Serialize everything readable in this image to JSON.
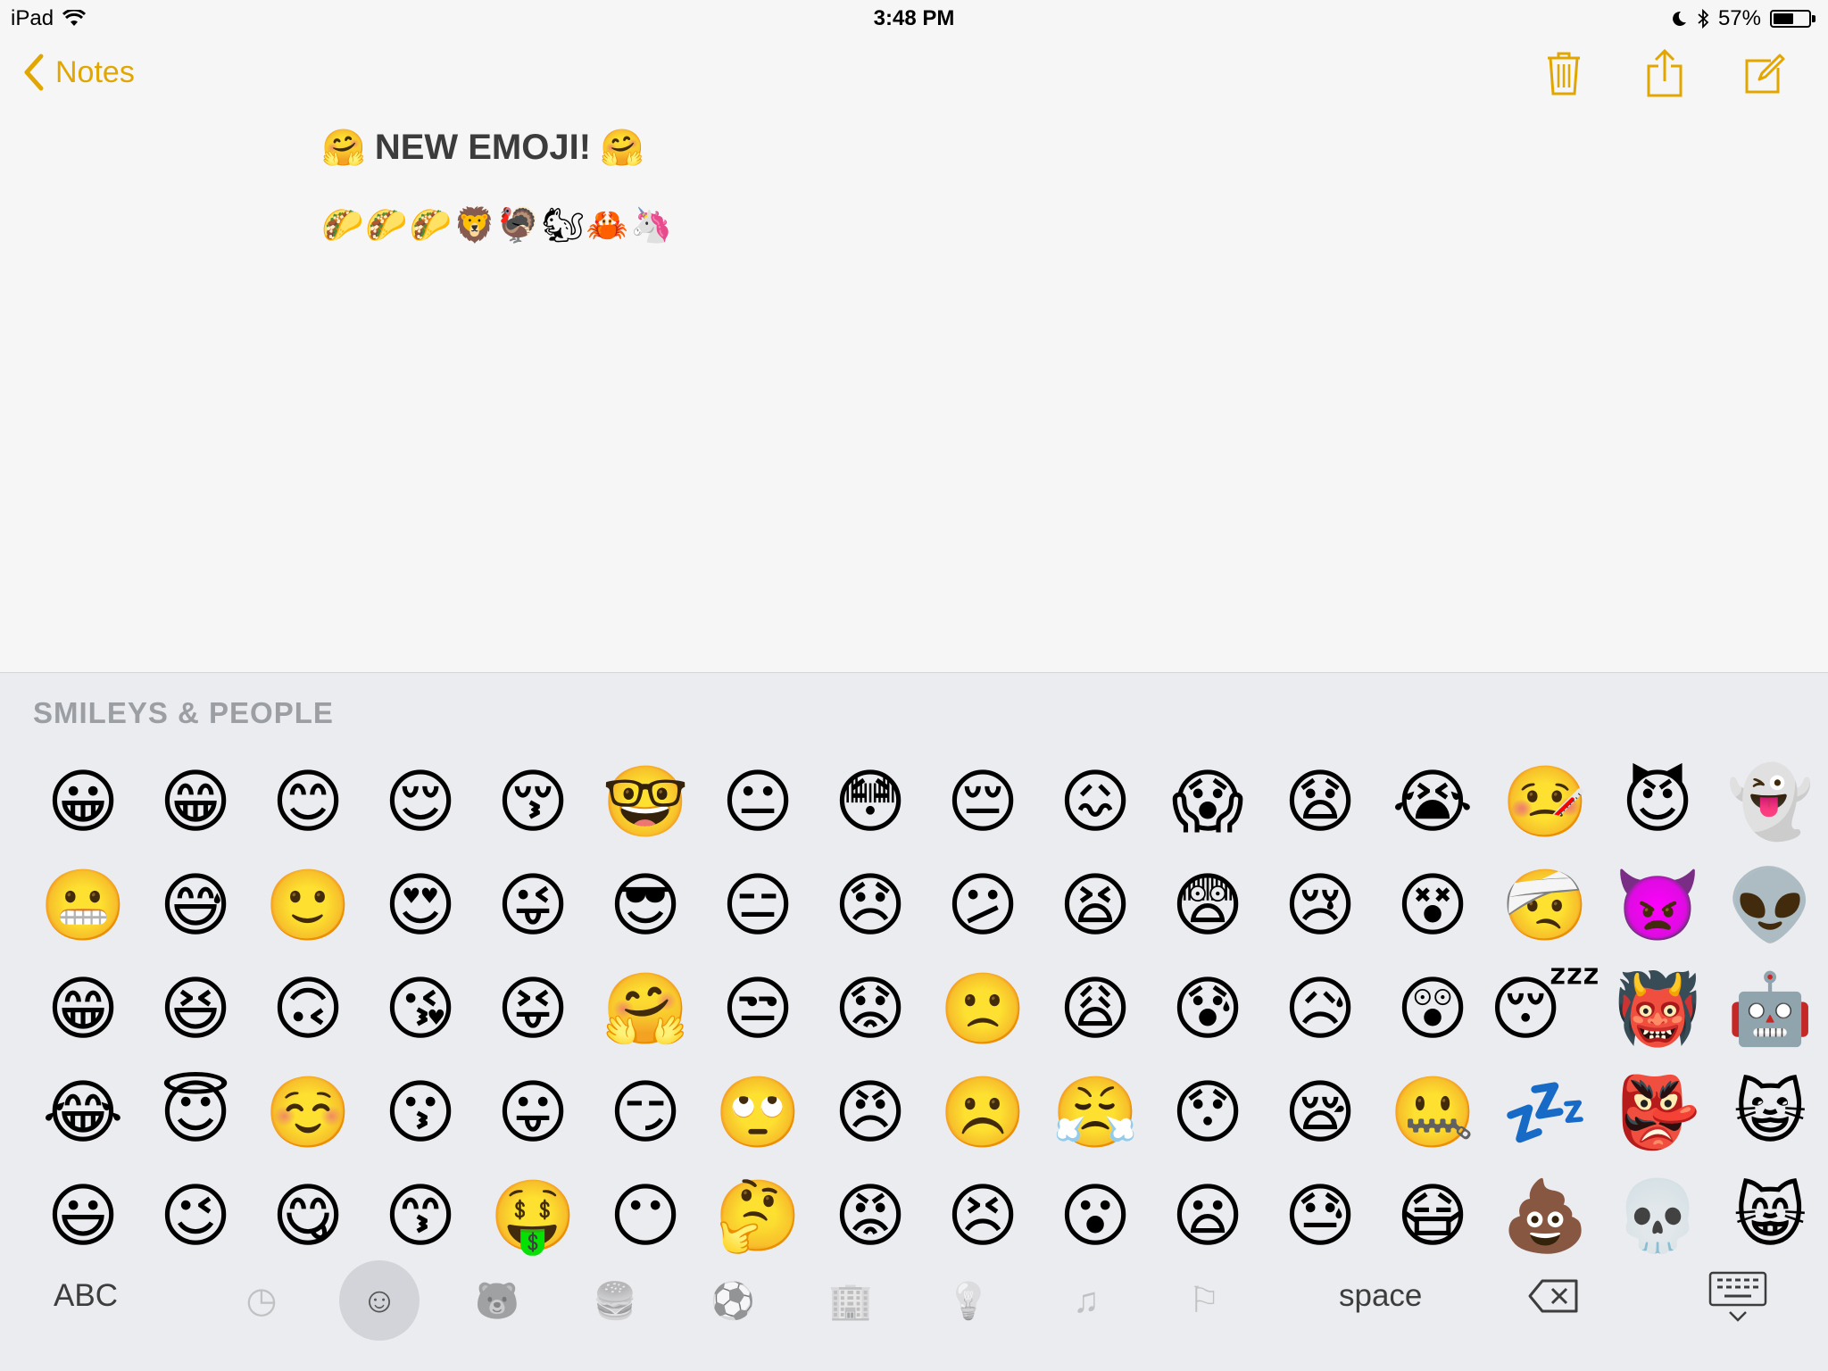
{
  "status_bar": {
    "device": "iPad",
    "time": "3:48 PM",
    "battery_percent": "57%",
    "battery_level": 0.57,
    "icons": [
      "wifi-icon",
      "moon-icon",
      "bluetooth-icon",
      "battery-icon"
    ]
  },
  "nav": {
    "back_label": "Notes",
    "accent_color": "#e1a700",
    "actions": [
      "trash-icon",
      "share-icon",
      "compose-icon"
    ]
  },
  "note": {
    "title_emoji": "🤗",
    "title_text": "NEW EMOJI!",
    "line2": "🌮🌮🌮🦁🦃🐿🦀🦄"
  },
  "keyboard": {
    "category_title": "SMILEYS & PEOPLE",
    "emoji_rows": [
      [
        "😀",
        "😁",
        "😊",
        "😌",
        "😚",
        "🤓",
        "😐",
        "😳",
        "😔",
        "😖",
        "😱",
        "😧",
        "😭",
        "🤒",
        "😈",
        "👻"
      ],
      [
        "😬",
        "😅",
        "🙂",
        "😍",
        "😜",
        "😎",
        "😑",
        "😞",
        "😕",
        "😫",
        "😨",
        "😢",
        "😵",
        "🤕",
        "👿",
        "👽"
      ],
      [
        "😁",
        "😆",
        "🙃",
        "😘",
        "😝",
        "🤗",
        "😒",
        "😟",
        "🙁",
        "😩",
        "😰",
        "😥",
        "😲",
        "😴",
        "👹",
        "🤖"
      ],
      [
        "😂",
        "😇",
        "☺️",
        "😗",
        "😛",
        "😏",
        "🙄",
        "😠",
        "☹️",
        "😤",
        "😯",
        "😪",
        "🤐",
        "💤",
        "👺",
        "😺"
      ],
      [
        "😃",
        "😉",
        "😋",
        "😙",
        "🤑",
        "😶",
        "🤔",
        "😡",
        "😣",
        "😮",
        "😦",
        "😓",
        "😷",
        "💩",
        "💀",
        "😸"
      ]
    ],
    "bottom": {
      "abc_label": "ABC",
      "space_label": "space",
      "categories": [
        {
          "name": "recent-icon",
          "glyph": "◷",
          "active": false
        },
        {
          "name": "smileys-icon",
          "glyph": "☺",
          "active": true
        },
        {
          "name": "animals-icon",
          "glyph": "🐻",
          "active": false
        },
        {
          "name": "food-icon",
          "glyph": "🍔",
          "active": false
        },
        {
          "name": "activity-icon",
          "glyph": "⚽",
          "active": false
        },
        {
          "name": "travel-icon",
          "glyph": "🏢",
          "active": false
        },
        {
          "name": "objects-icon",
          "glyph": "💡",
          "active": false
        },
        {
          "name": "symbols-icon",
          "glyph": "♫",
          "active": false
        },
        {
          "name": "flags-icon",
          "glyph": "⚐",
          "active": false
        }
      ]
    }
  }
}
